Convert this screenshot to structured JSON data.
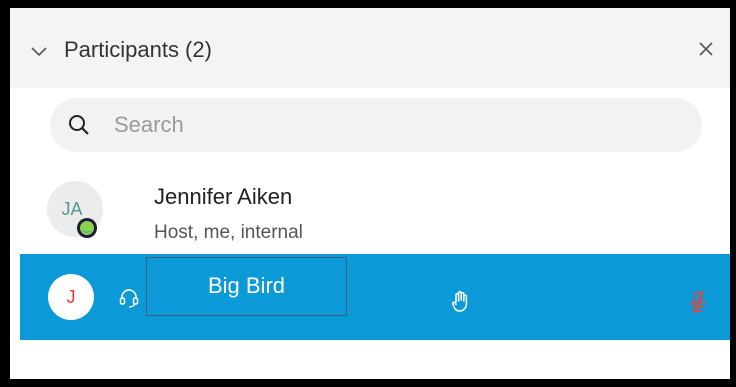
{
  "header": {
    "title": "Participants (2)",
    "collapse_icon": "chevron-down-icon",
    "close_icon": "close-icon"
  },
  "search": {
    "placeholder": "Search",
    "value": "",
    "icon": "search-icon"
  },
  "participants": [
    {
      "initials": "JA",
      "name": "Jennifer Aiken",
      "subtitle": "Host, me, internal",
      "presence_icon": "webex-status-icon"
    },
    {
      "initials": "J",
      "name": "Big Bird",
      "audio_icon": "headset-icon",
      "hand_icon": "raise-hand-icon",
      "mic_icon": "muted-mic-icon",
      "selected": true
    }
  ],
  "colors": {
    "selected_row": "#0b9ad7",
    "muted_mic": "#e0443c",
    "avatar_text_host": "#4f9a8f",
    "avatar_text_guest": "#e03c3c"
  }
}
